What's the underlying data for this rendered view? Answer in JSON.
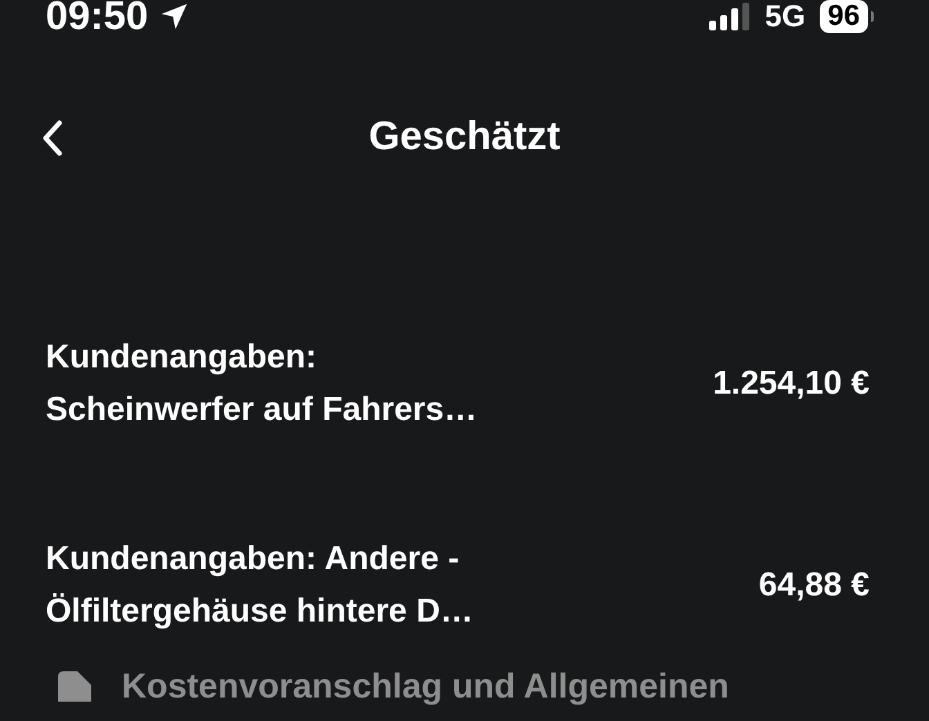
{
  "status_bar": {
    "time": "09:50",
    "network": "5G",
    "battery": "96"
  },
  "header": {
    "title": "Geschätzt"
  },
  "items": [
    {
      "lines": [
        "Kundenangaben:",
        "Scheinwerfer auf Fahrers…"
      ],
      "amount": "1.254,10 €"
    },
    {
      "lines": [
        "Kundenangaben: Andere -",
        "Ölfiltergehäuse hintere D…"
      ],
      "amount": "64,88 €"
    }
  ],
  "footer_link": {
    "label": "Kostenvoranschlag und Allgemeinen"
  }
}
